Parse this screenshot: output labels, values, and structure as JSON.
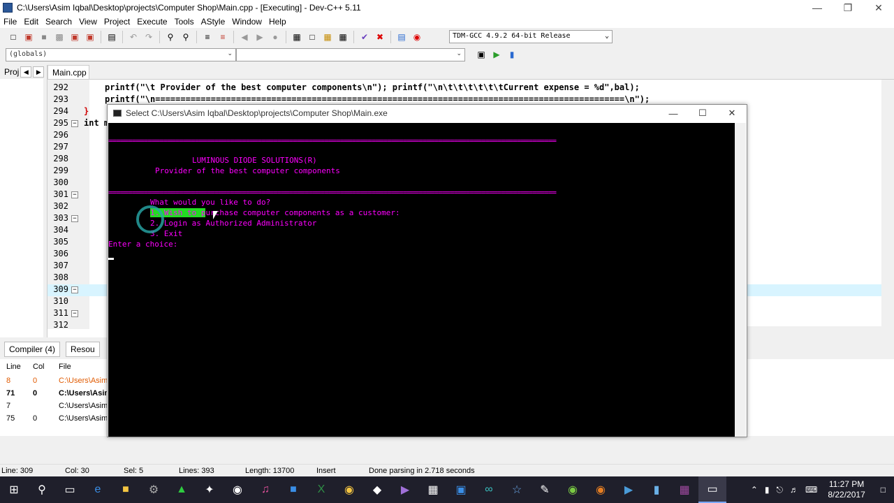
{
  "window": {
    "title": "C:\\Users\\Asim Iqbal\\Desktop\\projects\\Computer Shop\\Main.cpp - [Executing] - Dev-C++ 5.11"
  },
  "menu": [
    "File",
    "Edit",
    "Search",
    "View",
    "Project",
    "Execute",
    "Tools",
    "AStyle",
    "Window",
    "Help"
  ],
  "toolbar": {
    "compiler": "TDM-GCC 4.9.2 64-bit Release"
  },
  "scope": {
    "globals": "(globals)"
  },
  "project_panel": {
    "tab_label": "Proj"
  },
  "editor": {
    "file_tab": "Main.cpp",
    "lines": [
      {
        "n": "292",
        "code": "printf(\"\\t Provider of the best computer components\\n\"); printf(\"\\n\\t\\t\\t\\t\\t\\tCurrent expense = %d\",bal);"
      },
      {
        "n": "293",
        "code": "printf(\"\\n=============================================================================================\\n\");"
      },
      {
        "n": "294",
        "code": "}"
      },
      {
        "n": "295",
        "code": "int m"
      },
      {
        "n": "296",
        "code": ""
      },
      {
        "n": "297",
        "code": ""
      },
      {
        "n": "298",
        "code": ""
      },
      {
        "n": "299",
        "code": ""
      },
      {
        "n": "300",
        "code": ""
      },
      {
        "n": "301",
        "code": ""
      },
      {
        "n": "302",
        "code": ""
      },
      {
        "n": "303",
        "code": ""
      },
      {
        "n": "304",
        "code": ""
      },
      {
        "n": "305",
        "code": ""
      },
      {
        "n": "306",
        "code": ""
      },
      {
        "n": "307",
        "code": ""
      },
      {
        "n": "308",
        "code": ""
      },
      {
        "n": "309",
        "code": ""
      },
      {
        "n": "310",
        "code": ""
      },
      {
        "n": "311",
        "code": ""
      },
      {
        "n": "312",
        "code": ""
      }
    ]
  },
  "console": {
    "title": "Select C:\\Users\\Asim Iqbal\\Desktop\\projects\\Computer Shop\\Main.exe",
    "rule": "==================================================================================================================",
    "heading": "LUMINOUS DIODE SOLUTIONS(R)",
    "subheading": "Provider of the best computer components",
    "prompt": "What would you like to do?",
    "option1_selected": "1. Wish to p",
    "option1_rest": "urchase computer components as a customer:",
    "option2": "2. Login as Authorized Administrator",
    "option3": "3. Exit",
    "enter_choice": "Enter a choice:"
  },
  "bottom_panel": {
    "tab_compiler": "Compiler (4)",
    "tab_resources": "Resou",
    "headers": {
      "line": "Line",
      "col": "Col",
      "file": "File"
    },
    "rows": [
      {
        "line": "8",
        "col": "0",
        "file": "C:\\Users\\Asim",
        "color": "#e05a00"
      },
      {
        "line": "71",
        "col": "0",
        "file": "C:\\Users\\Asim",
        "color": "#000000"
      },
      {
        "line": "7",
        "col": "",
        "file": "C:\\Users\\Asim",
        "color": "#000000"
      },
      {
        "line": "75",
        "col": "0",
        "file": "C:\\Users\\Asim",
        "color": "#000000"
      }
    ]
  },
  "status": {
    "line": "Line:   309",
    "col": "Col:   30",
    "sel": "Sel:   5",
    "lines": "Lines:   393",
    "length": "Length: 13700",
    "mode": "Insert",
    "parse": "Done parsing in 2.718 seconds"
  },
  "taskbar": {
    "time": "11:27 PM",
    "date": "8/22/2017"
  },
  "colors": {
    "console_text": "#ff00ff",
    "console_bg": "#000000",
    "selection": "#22dd22"
  }
}
